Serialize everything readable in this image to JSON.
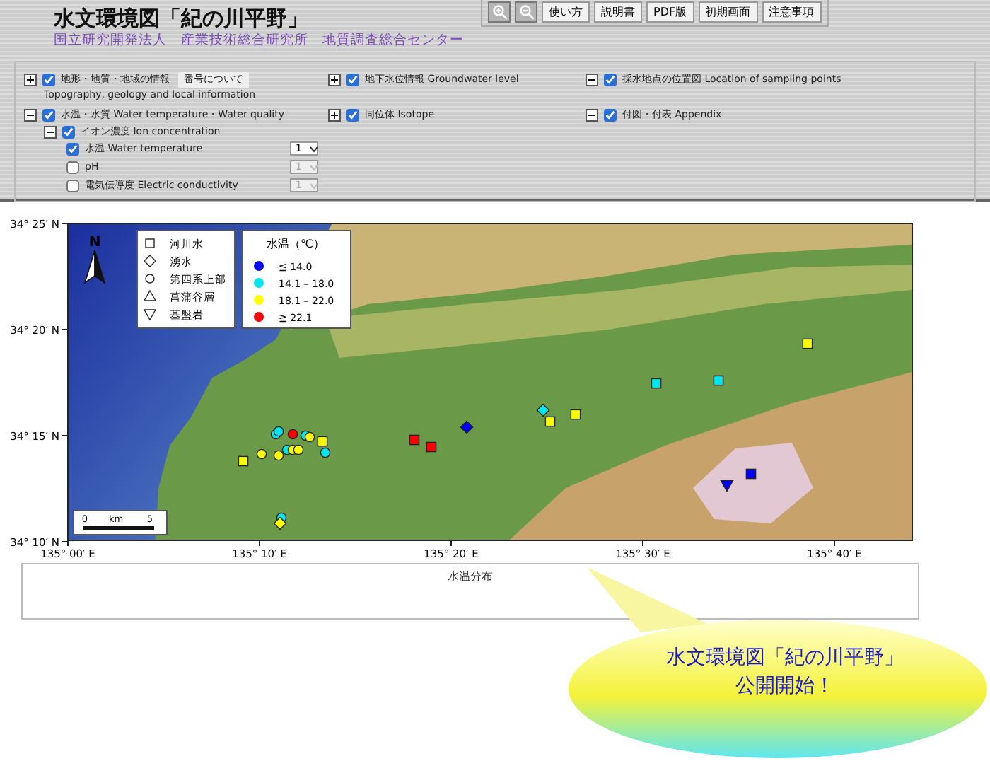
{
  "header": {
    "title": "水文環境図「紀の川平野」",
    "subtitle": "国立研究開発法人　産業技術総合研究所　地質調査総合センター",
    "tools": [
      {
        "kind": "zoom-in"
      },
      {
        "kind": "zoom-out"
      }
    ],
    "buttons": [
      "使い方",
      "説明書",
      "PDF版",
      "初期画面",
      "注意事項"
    ]
  },
  "layers": [
    {
      "label": "地形・地質・地域の情報",
      "note": "番号について",
      "sublabel": "Topography, geology and local information",
      "expanded": false,
      "checked": true
    },
    {
      "label": "地下水位情報 Groundwater level",
      "expanded": false,
      "checked": true
    },
    {
      "label": "採水地点の位置図 Location of sampling points",
      "expanded": true,
      "checked": true
    },
    {
      "label": "水温・水質 Water temperature・Water quality",
      "expanded": true,
      "checked": true,
      "children": [
        {
          "label": "イオン濃度 Ion concentration",
          "expanded": true,
          "checked": true,
          "children": [
            {
              "label": "水温 Water temperature",
              "checked": true,
              "select": {
                "value": "1",
                "disabled": false
              }
            },
            {
              "label": "pH",
              "checked": false,
              "select": {
                "value": "1",
                "disabled": true
              }
            },
            {
              "label": "電気伝導度 Electric conductivity",
              "checked": false,
              "select": {
                "value": "1",
                "disabled": true
              }
            }
          ]
        }
      ]
    },
    {
      "label": "同位体 Isotope",
      "expanded": false,
      "checked": true
    },
    {
      "label": "付図・付表 Appendix",
      "expanded": true,
      "checked": true
    }
  ],
  "map": {
    "north_label": "N",
    "scale_labels": [
      "0",
      "km",
      "5"
    ],
    "site_legend": [
      {
        "kind": "square",
        "label": "河川水"
      },
      {
        "kind": "diamond",
        "label": "湧水"
      },
      {
        "kind": "circle",
        "label": "第四系上部"
      },
      {
        "kind": "triangle",
        "label": "菖蒲谷層"
      },
      {
        "kind": "down-triangle",
        "label": "基盤岩"
      }
    ],
    "temp_legend": {
      "title": "水温（℃）",
      "items": [
        {
          "label": "≦ 14.0",
          "color": "#0000ff"
        },
        {
          "label": "14.1 – 18.0",
          "color": "#00e5ee"
        },
        {
          "label": "18.1 – 22.0",
          "color": "#ffff00"
        },
        {
          "label": "≧ 22.1",
          "color": "#ff0000"
        }
      ]
    },
    "lat_labels": [
      "34° 25′ N",
      "34° 20′ N",
      "34° 15′ N",
      "34° 10′ N"
    ],
    "lon_labels": [
      "135° 00′ E",
      "135° 10′ E",
      "135° 20′ E",
      "135° 30′ E",
      "135° 40′ E"
    ],
    "caption": "水温分布"
  },
  "bubble": [
    "水文環境図「紀の川平野」",
    "公開開始！"
  ]
}
